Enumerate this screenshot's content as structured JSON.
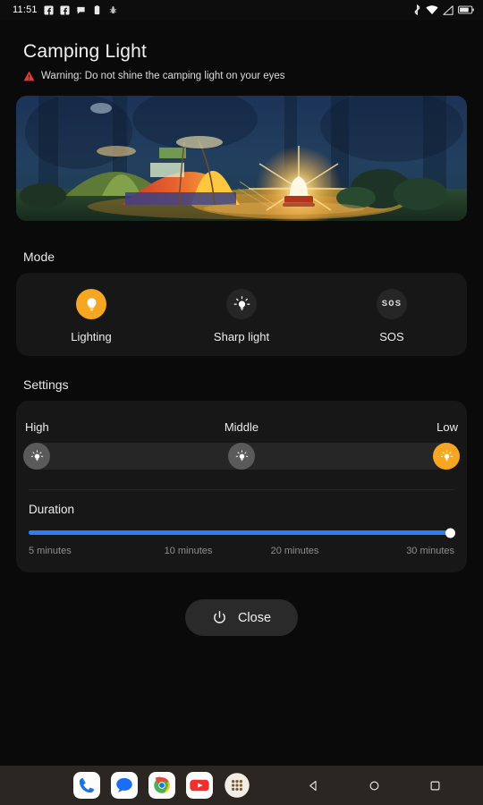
{
  "statusbar": {
    "time": "11:51",
    "left_icons": [
      "facebook-icon",
      "facebook-icon",
      "messenger-icon",
      "clipboard-icon",
      "bug-report-icon"
    ],
    "right_icons": [
      "bluetooth-icon",
      "wifi-icon",
      "signal-icon",
      "battery-icon"
    ]
  },
  "header": {
    "title": "Camping Light",
    "warning_icon": "warning-triangle-icon",
    "warning_text": "Warning: Do not shine the camping light on your eyes"
  },
  "hero": {
    "alt": "night camping scene with tents and glowing lantern"
  },
  "mode": {
    "label": "Mode",
    "items": [
      {
        "label": "Lighting",
        "icon": "lightbulb-icon",
        "selected": true
      },
      {
        "label": "Sharp light",
        "icon": "bright-lightbulb-icon",
        "selected": false
      },
      {
        "label": "SOS",
        "icon": "sos-icon",
        "icon_text": "SOS",
        "selected": false
      }
    ]
  },
  "settings": {
    "label": "Settings",
    "brightness": {
      "levels": [
        "High",
        "Middle",
        "Low"
      ],
      "selected": "Low"
    },
    "duration": {
      "title": "Duration",
      "ticks": [
        "5 minutes",
        "10 minutes",
        "20 minutes",
        "30 minutes"
      ],
      "value": "30 minutes",
      "percent": 100
    }
  },
  "close": {
    "label": "Close",
    "icon": "power-icon"
  },
  "dock": {
    "apps": [
      "phone-icon",
      "messages-icon",
      "chrome-icon",
      "youtube-icon",
      "app-drawer-icon"
    ],
    "nav": [
      "back-icon",
      "home-icon",
      "recents-icon"
    ]
  },
  "colors": {
    "accent_orange": "#f5a623",
    "slider_blue": "#2f7cf6",
    "warning_red": "#e53935",
    "card_bg": "#171717",
    "page_bg": "#0a0a0a"
  }
}
